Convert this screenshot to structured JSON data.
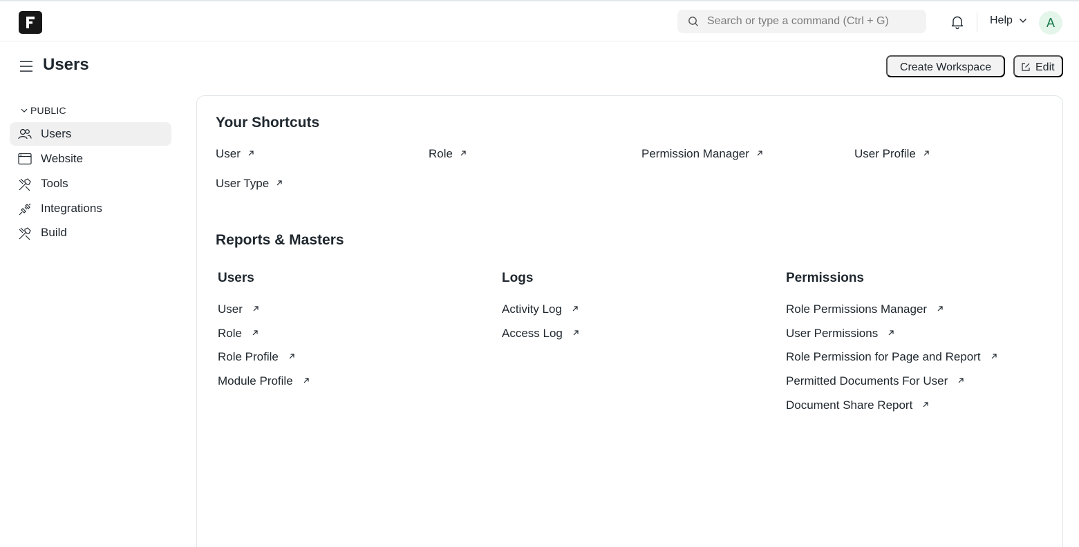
{
  "header": {
    "search_placeholder": "Search or type a command (Ctrl + G)",
    "help_label": "Help",
    "avatar_initial": "A"
  },
  "page": {
    "title": "Users",
    "create_workspace_label": "Create Workspace",
    "edit_label": "Edit"
  },
  "sidebar": {
    "section_label": "PUBLIC",
    "items": [
      {
        "label": "Users",
        "icon": "users-icon",
        "active": true
      },
      {
        "label": "Website",
        "icon": "website-icon"
      },
      {
        "label": "Tools",
        "icon": "tools-icon"
      },
      {
        "label": "Integrations",
        "icon": "integrations-icon"
      },
      {
        "label": "Build",
        "icon": "build-icon"
      }
    ]
  },
  "shortcuts": {
    "title": "Your Shortcuts",
    "items": [
      "User",
      "Role",
      "Permission Manager",
      "User Profile",
      "User Type"
    ]
  },
  "reports": {
    "title": "Reports & Masters",
    "columns": [
      {
        "title": "Users",
        "links": [
          "User",
          "Role",
          "Role Profile",
          "Module Profile"
        ]
      },
      {
        "title": "Logs",
        "links": [
          "Activity Log",
          "Access Log"
        ]
      },
      {
        "title": "Permissions",
        "links": [
          "Role Permissions Manager",
          "User Permissions",
          "Role Permission for Page and Report",
          "Permitted Documents For User",
          "Document Share Report"
        ]
      }
    ]
  },
  "colors": {
    "accent_bg": "#f3f3f3",
    "avatar_bg": "#e4f5e9",
    "avatar_text": "#16794c",
    "text": "#1f272e"
  }
}
